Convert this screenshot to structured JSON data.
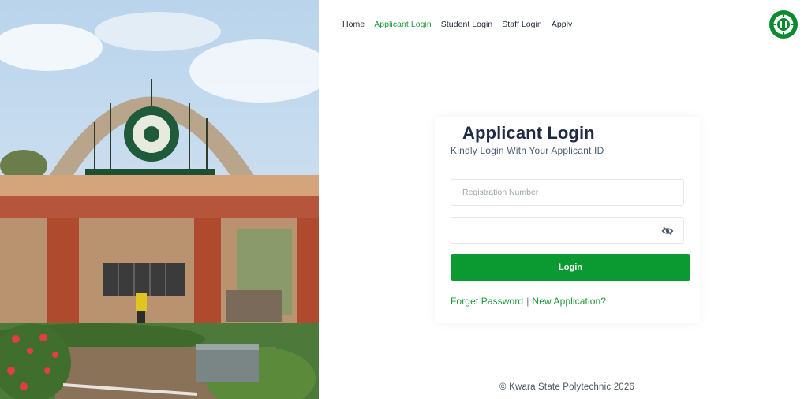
{
  "nav": {
    "items": [
      {
        "label": "Home",
        "active": false
      },
      {
        "label": "Applicant Login",
        "active": true
      },
      {
        "label": "Student Login",
        "active": false
      },
      {
        "label": "Staff Login",
        "active": false
      },
      {
        "label": "Apply",
        "active": false
      }
    ]
  },
  "logo": {
    "icon": "kwara-poly-crest-icon",
    "color": "#0b8a2e"
  },
  "login": {
    "title": "Applicant Login",
    "subtitle": "Kindly Login With Your Applicant ID",
    "registration": {
      "placeholder": "Registration Number",
      "value": ""
    },
    "password": {
      "placeholder": "",
      "value": "",
      "toggle_icon": "eye-off-icon"
    },
    "button_label": "Login",
    "forget_password": "Forget Password",
    "separator": "|",
    "new_application": "New Application?"
  },
  "footer": {
    "text": "© Kwara State Polytechnic 2026"
  },
  "colors": {
    "accent": "#0b9a32",
    "link": "#1e9a3a",
    "title": "#1f2a44"
  },
  "photo": {
    "description_icon": "campus-gate-photo"
  }
}
